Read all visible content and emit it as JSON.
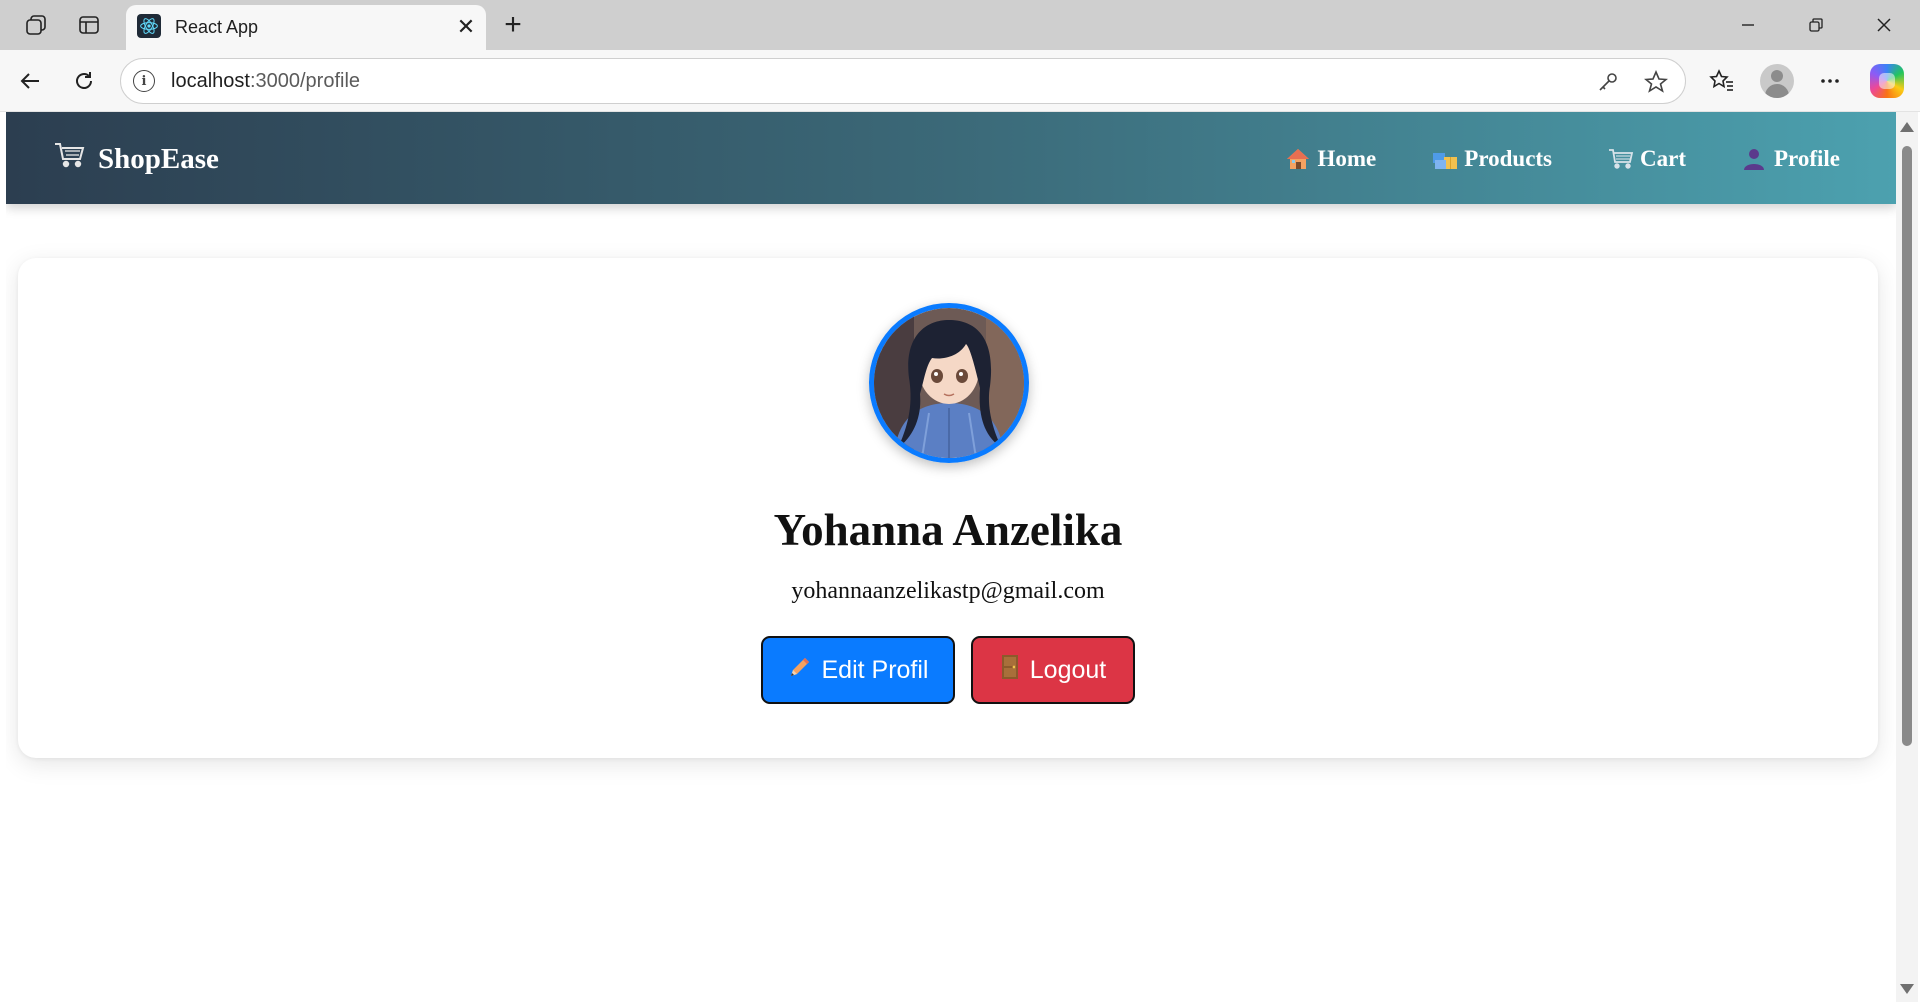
{
  "browser": {
    "tab_title": "React App",
    "url_host": "localhost",
    "url_path": ":3000/profile"
  },
  "navbar": {
    "brand": "ShopEase",
    "brand_icon": "shopping-cart-icon",
    "links": [
      {
        "label": "Home",
        "icon": "house-icon"
      },
      {
        "label": "Products",
        "icon": "boxes-icon"
      },
      {
        "label": "Cart",
        "icon": "cart-icon"
      },
      {
        "label": "Profile",
        "icon": "person-icon"
      }
    ],
    "gradient": [
      "#2c3e50",
      "#4ca1af"
    ]
  },
  "profile": {
    "name": "Yohanna Anzelika",
    "email": "yohannaanzelikastp@gmail.com",
    "avatar_border": "#0a7bff",
    "edit_label": "Edit Profil",
    "logout_label": "Logout",
    "edit_color": "#0a7bff",
    "logout_color": "#dc3545"
  }
}
